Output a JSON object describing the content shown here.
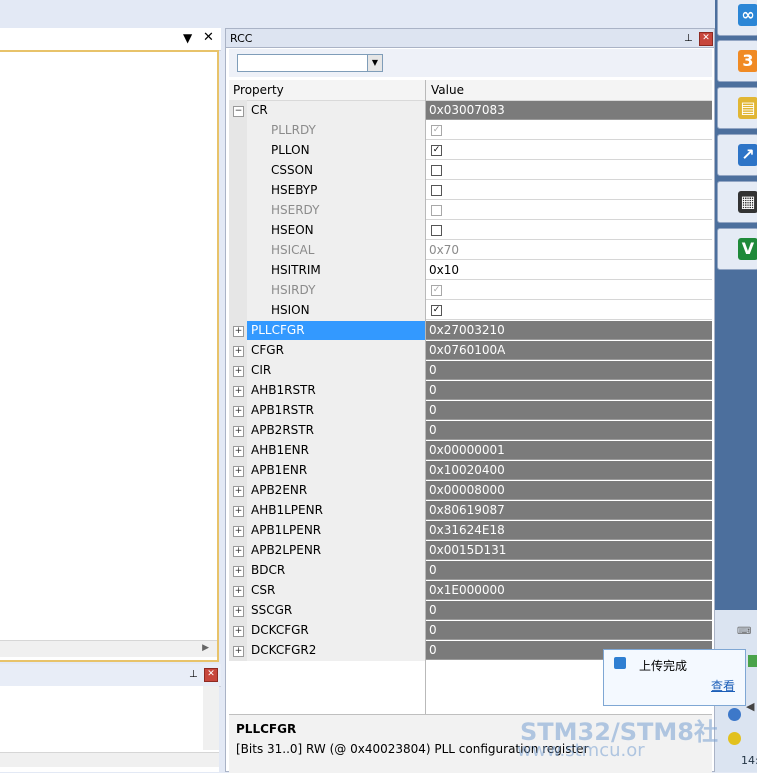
{
  "left_pane": {
    "bottom_title": ""
  },
  "rcc_panel": {
    "title": "RCC",
    "combo_value": "",
    "header": {
      "property": "Property",
      "value": "Value"
    },
    "rows": [
      {
        "name": "CR",
        "value": "0x03007083",
        "expanded": true,
        "selected": false
      },
      {
        "name": "PLLRDY",
        "value": "",
        "checked": true,
        "disabled": true,
        "child": true
      },
      {
        "name": "PLLON",
        "value": "",
        "checked": true,
        "disabled": false,
        "child": true
      },
      {
        "name": "CSSON",
        "value": "",
        "checked": false,
        "disabled": false,
        "child": true
      },
      {
        "name": "HSEBYP",
        "value": "",
        "checked": false,
        "disabled": false,
        "child": true
      },
      {
        "name": "HSERDY",
        "value": "",
        "checked": false,
        "disabled": true,
        "child": true
      },
      {
        "name": "HSEON",
        "value": "",
        "checked": false,
        "disabled": false,
        "child": true
      },
      {
        "name": "HSICAL",
        "value": "0x70",
        "disabled": true,
        "child": true,
        "text": true
      },
      {
        "name": "HSITRIM",
        "value": "0x10",
        "disabled": false,
        "child": true,
        "text": true
      },
      {
        "name": "HSIRDY",
        "value": "",
        "checked": true,
        "disabled": true,
        "child": true
      },
      {
        "name": "HSION",
        "value": "",
        "checked": true,
        "disabled": false,
        "child": true
      },
      {
        "name": "PLLCFGR",
        "value": "0x27003210",
        "selected": true
      },
      {
        "name": "CFGR",
        "value": "0x0760100A"
      },
      {
        "name": "CIR",
        "value": "0"
      },
      {
        "name": "AHB1RSTR",
        "value": "0"
      },
      {
        "name": "APB1RSTR",
        "value": "0"
      },
      {
        "name": "APB2RSTR",
        "value": "0"
      },
      {
        "name": "AHB1ENR",
        "value": "0x00000001"
      },
      {
        "name": "APB1ENR",
        "value": "0x10020400"
      },
      {
        "name": "APB2ENR",
        "value": "0x00008000"
      },
      {
        "name": "AHB1LPENR",
        "value": "0x80619087"
      },
      {
        "name": "APB1LPENR",
        "value": "0x31624E18"
      },
      {
        "name": "APB2LPENR",
        "value": "0x0015D131"
      },
      {
        "name": "BDCR",
        "value": "0"
      },
      {
        "name": "CSR",
        "value": "0x1E000000"
      },
      {
        "name": "SSCGR",
        "value": "0"
      },
      {
        "name": "DCKCFGR",
        "value": "0"
      },
      {
        "name": "DCKCFGR2",
        "value": "0"
      }
    ],
    "description": {
      "title": "PLLCFGR",
      "text": "[Bits 31..0] RW (@ 0x40023804) PLL configuration register"
    }
  },
  "notification": {
    "message": "上传完成",
    "link": "查看"
  },
  "watermark": {
    "line1": "STM32/STM8社",
    "line2": "www.stmcu.or"
  },
  "taskbar": {
    "clock": "14:",
    "icons": [
      "link-icon",
      "orange-app-icon",
      "folder-app-icon",
      "chart-app-icon",
      "chip-app-icon",
      "green-v-app-icon"
    ]
  }
}
